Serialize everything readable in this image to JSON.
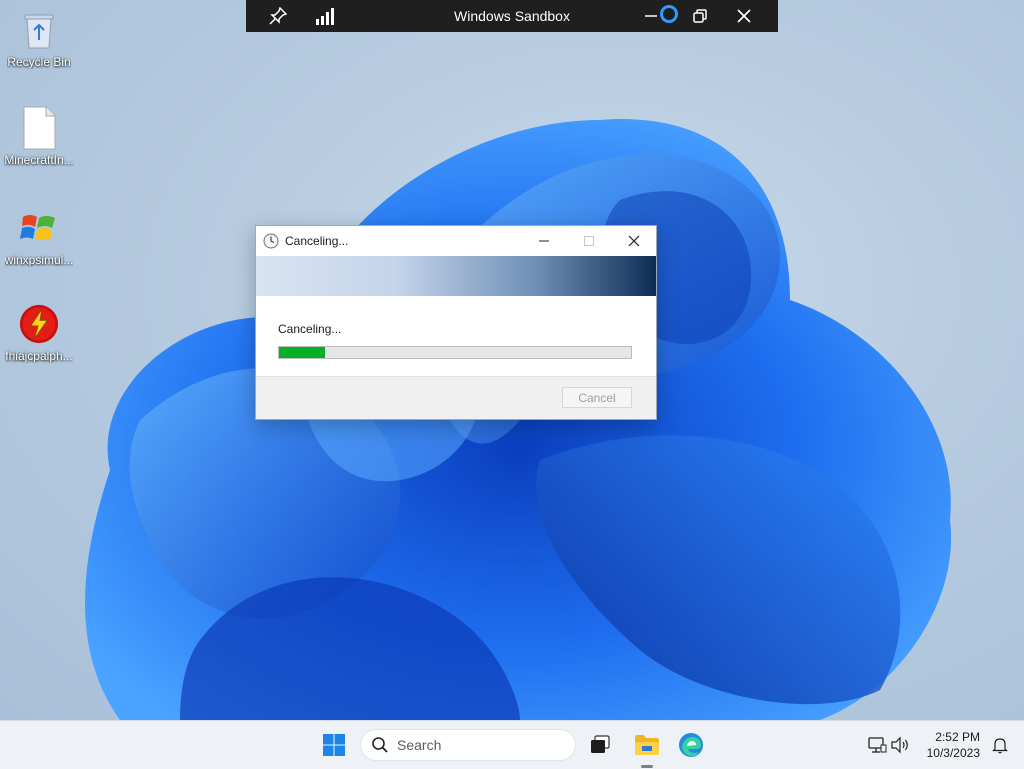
{
  "sandbox_bar": {
    "title": "Windows Sandbox",
    "icons": [
      "pin-icon",
      "signal-icon",
      "minimize-icon",
      "restore-icon",
      "close-icon"
    ]
  },
  "desktop": {
    "icons": [
      {
        "label": "Recycle Bin",
        "icon": "recycle-bin-icon"
      },
      {
        "label": "MinecraftIn...",
        "icon": "document-icon"
      },
      {
        "label": "winxpsimul...",
        "icon": "windows-xp-logo-icon"
      },
      {
        "label": "fhiajcpalph...",
        "icon": "lightning-app-icon"
      }
    ]
  },
  "dialog": {
    "title": "Canceling...",
    "message": "Canceling...",
    "progress": 0.13,
    "cancel_label": "Cancel",
    "colors": {
      "progress_fill": "#06b025",
      "banner_dark": "#0f2c55"
    }
  },
  "taskbar": {
    "search_placeholder": "Search",
    "time": "2:52 PM",
    "date": "10/3/2023",
    "pinned": [
      "start-icon",
      "search-icon",
      "task-view-icon",
      "file-explorer-icon",
      "edge-icon"
    ],
    "tray": [
      "network-icon",
      "volume-icon",
      "notification-bell-icon"
    ]
  }
}
